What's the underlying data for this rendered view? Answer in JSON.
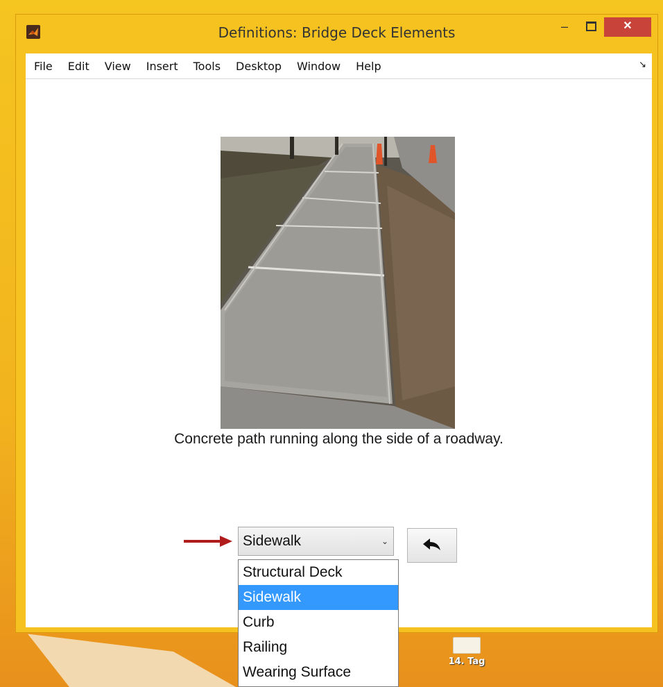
{
  "window": {
    "title": "Definitions: Bridge Deck Elements",
    "minimize_glyph": "–",
    "close_glyph": "✕"
  },
  "menu": {
    "items": [
      "File",
      "Edit",
      "View",
      "Insert",
      "Tools",
      "Desktop",
      "Window",
      "Help"
    ],
    "dock_glyph": "↘"
  },
  "figure": {
    "caption": "Concrete path running along the side of a roadway."
  },
  "popup": {
    "selected": "Sidewalk",
    "arrow_glyph": "⌄",
    "options": [
      "Structural Deck",
      "Sidewalk",
      "Curb",
      "Railing",
      "Wearing Surface"
    ],
    "highlighted_index": 1
  },
  "desktop": {
    "shortcut_label": "14. Tag"
  },
  "colors": {
    "window_frame": "#f5c21f",
    "close_button": "#c8443a",
    "selection": "#3399ff",
    "annotation_arrow": "#b01c1c"
  }
}
